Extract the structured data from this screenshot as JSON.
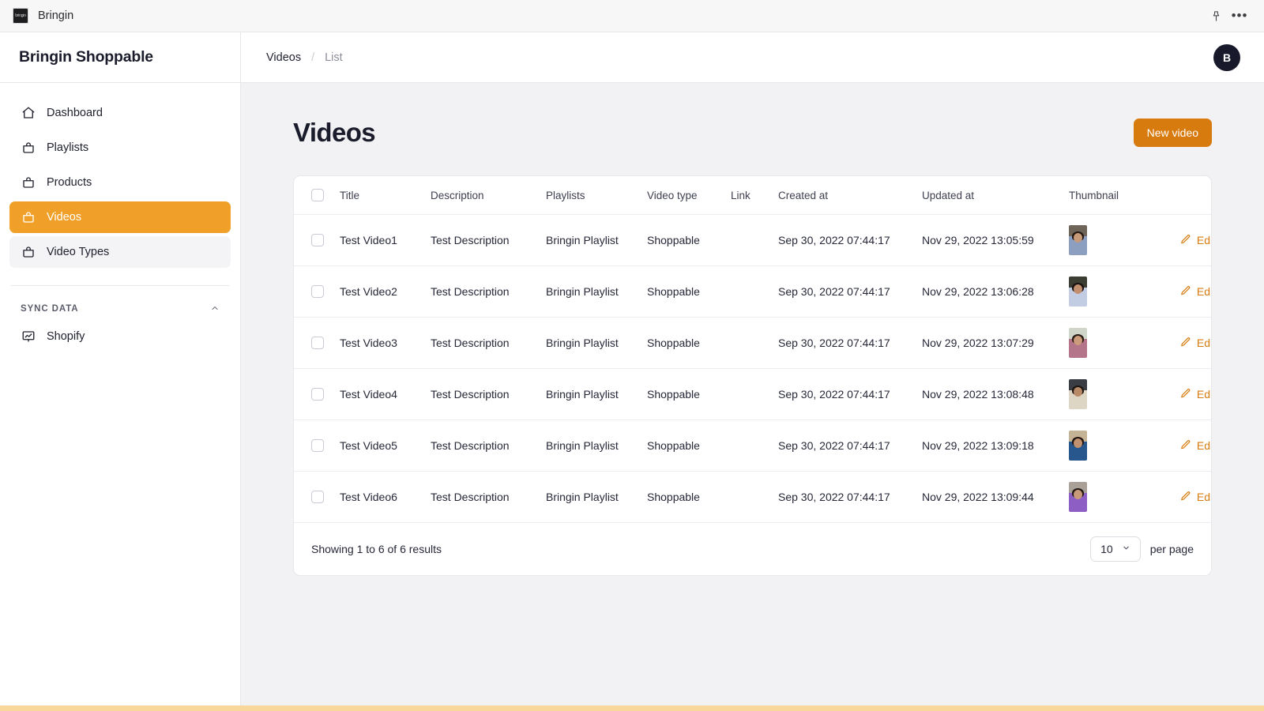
{
  "window": {
    "app_name": "Bringin",
    "logo_text": "bringin",
    "pin_icon": "pin-icon",
    "more_icon": "more-horizontal-icon"
  },
  "sidebar": {
    "brand": "Bringin Shoppable",
    "items": [
      {
        "label": "Dashboard",
        "icon": "home-icon",
        "state": "default"
      },
      {
        "label": "Playlists",
        "icon": "bag-icon",
        "state": "default"
      },
      {
        "label": "Products",
        "icon": "bag-icon",
        "state": "default"
      },
      {
        "label": "Videos",
        "icon": "bag-icon",
        "state": "active"
      },
      {
        "label": "Video Types",
        "icon": "bag-icon",
        "state": "hovered"
      }
    ],
    "section": {
      "title": "SYNC DATA",
      "collapse_icon": "chevron-up-icon",
      "items": [
        {
          "label": "Shopify",
          "icon": "presentation-chart-icon"
        }
      ]
    }
  },
  "topbar": {
    "breadcrumb": {
      "current": "Videos",
      "separator": "/",
      "sub": "List"
    },
    "avatar_initial": "B"
  },
  "page": {
    "title": "Videos",
    "new_button": "New video"
  },
  "table": {
    "select_all_checkbox": "unchecked",
    "headers": [
      "Title",
      "Description",
      "Playlists",
      "Video type",
      "Link",
      "Created at",
      "Updated at",
      "Thumbnail"
    ],
    "edit_label": "Edit",
    "edit_icon": "pencil-icon",
    "rows": [
      {
        "title": "Test Video1",
        "description": "Test Description",
        "playlists": "Bringin Playlist",
        "video_type": "Shoppable",
        "link": "",
        "created_at": "Sep 30, 2022 07:44:17",
        "updated_at": "Nov 29, 2022 13:05:59",
        "thumbnail": {
          "sky": "#6f6458",
          "body": "#8d9fc0",
          "hair": "#241812",
          "face": "#c79a7a"
        }
      },
      {
        "title": "Test Video2",
        "description": "Test Description",
        "playlists": "Bringin Playlist",
        "video_type": "Shoppable",
        "link": "",
        "created_at": "Sep 30, 2022 07:44:17",
        "updated_at": "Nov 29, 2022 13:06:28",
        "thumbnail": {
          "sky": "#3b3d33",
          "body": "#c2cde4",
          "hair": "#1a1110",
          "face": "#c2906f"
        }
      },
      {
        "title": "Test Video3",
        "description": "Test Description",
        "playlists": "Bringin Playlist",
        "video_type": "Shoppable",
        "link": "",
        "created_at": "Sep 30, 2022 07:44:17",
        "updated_at": "Nov 29, 2022 13:07:29",
        "thumbnail": {
          "sky": "#cfd6c9",
          "body": "#b4748a",
          "hair": "#2b1b15",
          "face": "#cb9b7b"
        }
      },
      {
        "title": "Test Video4",
        "description": "Test Description",
        "playlists": "Bringin Playlist",
        "video_type": "Shoppable",
        "link": "",
        "created_at": "Sep 30, 2022 07:44:17",
        "updated_at": "Nov 29, 2022 13:08:48",
        "thumbnail": {
          "sky": "#3a3e44",
          "body": "#ddd6c4",
          "hair": "#1d1512",
          "face": "#b98a68"
        }
      },
      {
        "title": "Test Video5",
        "description": "Test Description",
        "playlists": "Bringin Playlist",
        "video_type": "Shoppable",
        "link": "",
        "created_at": "Sep 30, 2022 07:44:17",
        "updated_at": "Nov 29, 2022 13:09:18",
        "thumbnail": {
          "sky": "#c4b394",
          "body": "#27578c",
          "hair": "#201512",
          "face": "#c2916f"
        }
      },
      {
        "title": "Test Video6",
        "description": "Test Description",
        "playlists": "Bringin Playlist",
        "video_type": "Shoppable",
        "link": "",
        "created_at": "Sep 30, 2022 07:44:17",
        "updated_at": "Nov 29, 2022 13:09:44",
        "thumbnail": {
          "sky": "#a9a098",
          "body": "#8d5fc4",
          "hair": "#221713",
          "face": "#c99a79"
        }
      }
    ],
    "footer": {
      "showing": "Showing 1 to 6 of 6 results",
      "per_page_value": "10",
      "per_page_label": "per page",
      "chevron_icon": "chevron-down-icon"
    }
  },
  "colors": {
    "accent_orange": "#d87b0e",
    "sidebar_active": "#f0a028",
    "bottom_bar": "#f9d69a",
    "canvas": "#f2f2f5",
    "text_dark": "#1a1c2b"
  }
}
